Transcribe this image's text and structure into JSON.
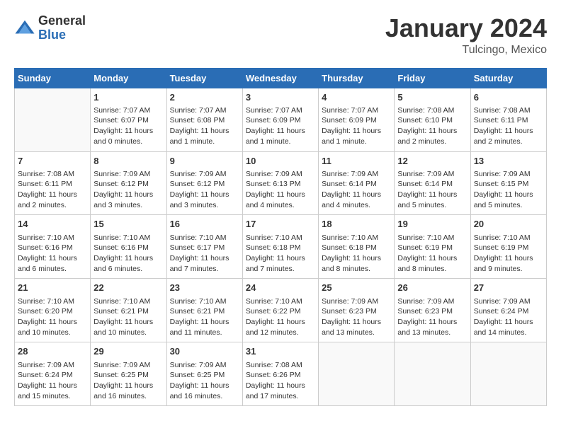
{
  "logo": {
    "general": "General",
    "blue": "Blue"
  },
  "title": "January 2024",
  "location": "Tulcingo, Mexico",
  "weekdays": [
    "Sunday",
    "Monday",
    "Tuesday",
    "Wednesday",
    "Thursday",
    "Friday",
    "Saturday"
  ],
  "weeks": [
    [
      {
        "day": "",
        "sunrise": "",
        "sunset": "",
        "daylight": ""
      },
      {
        "day": "1",
        "sunrise": "Sunrise: 7:07 AM",
        "sunset": "Sunset: 6:07 PM",
        "daylight": "Daylight: 11 hours and 0 minutes."
      },
      {
        "day": "2",
        "sunrise": "Sunrise: 7:07 AM",
        "sunset": "Sunset: 6:08 PM",
        "daylight": "Daylight: 11 hours and 1 minute."
      },
      {
        "day": "3",
        "sunrise": "Sunrise: 7:07 AM",
        "sunset": "Sunset: 6:09 PM",
        "daylight": "Daylight: 11 hours and 1 minute."
      },
      {
        "day": "4",
        "sunrise": "Sunrise: 7:07 AM",
        "sunset": "Sunset: 6:09 PM",
        "daylight": "Daylight: 11 hours and 1 minute."
      },
      {
        "day": "5",
        "sunrise": "Sunrise: 7:08 AM",
        "sunset": "Sunset: 6:10 PM",
        "daylight": "Daylight: 11 hours and 2 minutes."
      },
      {
        "day": "6",
        "sunrise": "Sunrise: 7:08 AM",
        "sunset": "Sunset: 6:11 PM",
        "daylight": "Daylight: 11 hours and 2 minutes."
      }
    ],
    [
      {
        "day": "7",
        "sunrise": "Sunrise: 7:08 AM",
        "sunset": "Sunset: 6:11 PM",
        "daylight": "Daylight: 11 hours and 2 minutes."
      },
      {
        "day": "8",
        "sunrise": "Sunrise: 7:09 AM",
        "sunset": "Sunset: 6:12 PM",
        "daylight": "Daylight: 11 hours and 3 minutes."
      },
      {
        "day": "9",
        "sunrise": "Sunrise: 7:09 AM",
        "sunset": "Sunset: 6:12 PM",
        "daylight": "Daylight: 11 hours and 3 minutes."
      },
      {
        "day": "10",
        "sunrise": "Sunrise: 7:09 AM",
        "sunset": "Sunset: 6:13 PM",
        "daylight": "Daylight: 11 hours and 4 minutes."
      },
      {
        "day": "11",
        "sunrise": "Sunrise: 7:09 AM",
        "sunset": "Sunset: 6:14 PM",
        "daylight": "Daylight: 11 hours and 4 minutes."
      },
      {
        "day": "12",
        "sunrise": "Sunrise: 7:09 AM",
        "sunset": "Sunset: 6:14 PM",
        "daylight": "Daylight: 11 hours and 5 minutes."
      },
      {
        "day": "13",
        "sunrise": "Sunrise: 7:09 AM",
        "sunset": "Sunset: 6:15 PM",
        "daylight": "Daylight: 11 hours and 5 minutes."
      }
    ],
    [
      {
        "day": "14",
        "sunrise": "Sunrise: 7:10 AM",
        "sunset": "Sunset: 6:16 PM",
        "daylight": "Daylight: 11 hours and 6 minutes."
      },
      {
        "day": "15",
        "sunrise": "Sunrise: 7:10 AM",
        "sunset": "Sunset: 6:16 PM",
        "daylight": "Daylight: 11 hours and 6 minutes."
      },
      {
        "day": "16",
        "sunrise": "Sunrise: 7:10 AM",
        "sunset": "Sunset: 6:17 PM",
        "daylight": "Daylight: 11 hours and 7 minutes."
      },
      {
        "day": "17",
        "sunrise": "Sunrise: 7:10 AM",
        "sunset": "Sunset: 6:18 PM",
        "daylight": "Daylight: 11 hours and 7 minutes."
      },
      {
        "day": "18",
        "sunrise": "Sunrise: 7:10 AM",
        "sunset": "Sunset: 6:18 PM",
        "daylight": "Daylight: 11 hours and 8 minutes."
      },
      {
        "day": "19",
        "sunrise": "Sunrise: 7:10 AM",
        "sunset": "Sunset: 6:19 PM",
        "daylight": "Daylight: 11 hours and 8 minutes."
      },
      {
        "day": "20",
        "sunrise": "Sunrise: 7:10 AM",
        "sunset": "Sunset: 6:19 PM",
        "daylight": "Daylight: 11 hours and 9 minutes."
      }
    ],
    [
      {
        "day": "21",
        "sunrise": "Sunrise: 7:10 AM",
        "sunset": "Sunset: 6:20 PM",
        "daylight": "Daylight: 11 hours and 10 minutes."
      },
      {
        "day": "22",
        "sunrise": "Sunrise: 7:10 AM",
        "sunset": "Sunset: 6:21 PM",
        "daylight": "Daylight: 11 hours and 10 minutes."
      },
      {
        "day": "23",
        "sunrise": "Sunrise: 7:10 AM",
        "sunset": "Sunset: 6:21 PM",
        "daylight": "Daylight: 11 hours and 11 minutes."
      },
      {
        "day": "24",
        "sunrise": "Sunrise: 7:10 AM",
        "sunset": "Sunset: 6:22 PM",
        "daylight": "Daylight: 11 hours and 12 minutes."
      },
      {
        "day": "25",
        "sunrise": "Sunrise: 7:09 AM",
        "sunset": "Sunset: 6:23 PM",
        "daylight": "Daylight: 11 hours and 13 minutes."
      },
      {
        "day": "26",
        "sunrise": "Sunrise: 7:09 AM",
        "sunset": "Sunset: 6:23 PM",
        "daylight": "Daylight: 11 hours and 13 minutes."
      },
      {
        "day": "27",
        "sunrise": "Sunrise: 7:09 AM",
        "sunset": "Sunset: 6:24 PM",
        "daylight": "Daylight: 11 hours and 14 minutes."
      }
    ],
    [
      {
        "day": "28",
        "sunrise": "Sunrise: 7:09 AM",
        "sunset": "Sunset: 6:24 PM",
        "daylight": "Daylight: 11 hours and 15 minutes."
      },
      {
        "day": "29",
        "sunrise": "Sunrise: 7:09 AM",
        "sunset": "Sunset: 6:25 PM",
        "daylight": "Daylight: 11 hours and 16 minutes."
      },
      {
        "day": "30",
        "sunrise": "Sunrise: 7:09 AM",
        "sunset": "Sunset: 6:25 PM",
        "daylight": "Daylight: 11 hours and 16 minutes."
      },
      {
        "day": "31",
        "sunrise": "Sunrise: 7:08 AM",
        "sunset": "Sunset: 6:26 PM",
        "daylight": "Daylight: 11 hours and 17 minutes."
      },
      {
        "day": "",
        "sunrise": "",
        "sunset": "",
        "daylight": ""
      },
      {
        "day": "",
        "sunrise": "",
        "sunset": "",
        "daylight": ""
      },
      {
        "day": "",
        "sunrise": "",
        "sunset": "",
        "daylight": ""
      }
    ]
  ]
}
